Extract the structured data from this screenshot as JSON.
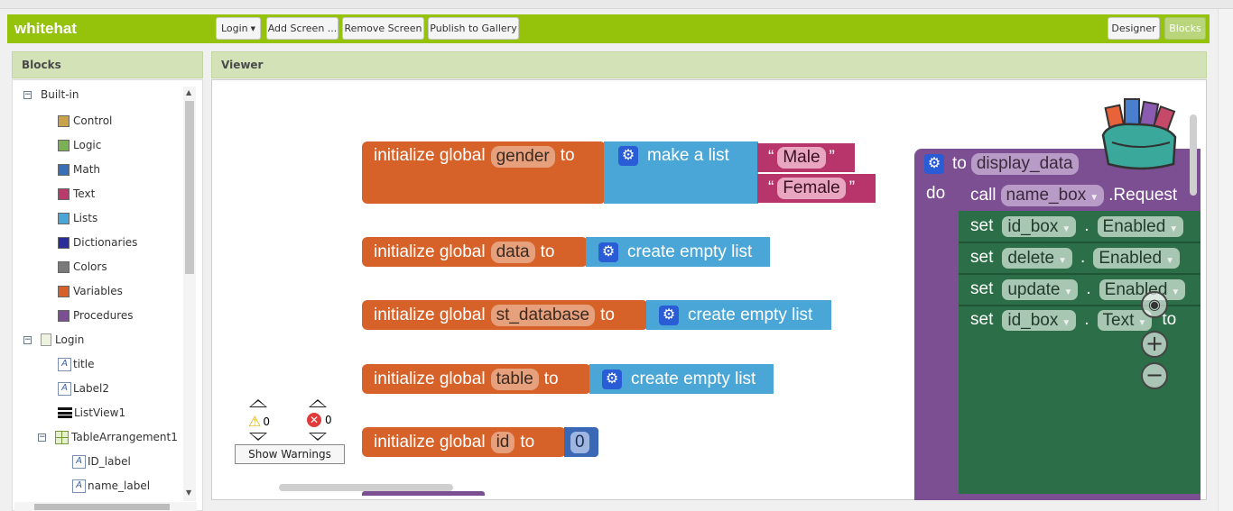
{
  "app": {
    "title": "whitehat",
    "screen_dropdown": "Login",
    "add_screen": "Add Screen ...",
    "remove_screen": "Remove Screen",
    "publish": "Publish to Gallery",
    "designer": "Designer",
    "blocks": "Blocks",
    "accent_color": "#95c30c"
  },
  "blocks_panel": {
    "title": "Blocks",
    "builtin_label": "Built-in",
    "builtin": [
      {
        "label": "Control",
        "color": "#c9a24a"
      },
      {
        "label": "Logic",
        "color": "#7bb154"
      },
      {
        "label": "Math",
        "color": "#3a6fb6"
      },
      {
        "label": "Text",
        "color": "#b93b6b"
      },
      {
        "label": "Lists",
        "color": "#4aa6d6"
      },
      {
        "label": "Dictionaries",
        "color": "#2c2c9a"
      },
      {
        "label": "Colors",
        "color": "#7a7a7a"
      },
      {
        "label": "Variables",
        "color": "#d6622a"
      },
      {
        "label": "Procedures",
        "color": "#7b4f91"
      }
    ],
    "screen_label": "Login",
    "components": [
      {
        "label": "title",
        "icon": "label-icon"
      },
      {
        "label": "Label2",
        "icon": "label-icon"
      },
      {
        "label": "ListView1",
        "icon": "listview-icon"
      }
    ],
    "table_arrangement": "TableArrangement1",
    "table_children": [
      {
        "label": "ID_label",
        "icon": "label-icon"
      },
      {
        "label": "name_label",
        "icon": "label-icon"
      }
    ]
  },
  "viewer": {
    "title": "Viewer",
    "warnings_count": "0",
    "errors_count": "0",
    "show_warnings": "Show Warnings"
  },
  "workspace": {
    "init_prefix": "initialize global",
    "to": "to",
    "make_a_list": "make a list",
    "create_empty_list": "create empty list",
    "quote": "“",
    "quote_close": "”",
    "globals": {
      "gender": "gender",
      "data": "data",
      "st_database": "st_database",
      "table": "table",
      "id": "id"
    },
    "list_items": [
      "Male",
      "Female"
    ],
    "id_value": "0",
    "procedure": {
      "to": "to",
      "name": "display_data",
      "do": "do",
      "call": "call",
      "call_component": "name_box",
      "call_method": ".Request",
      "set": "set",
      "dot": ".",
      "rows": [
        {
          "component": "id_box",
          "property": "Enabled"
        },
        {
          "component": "delete",
          "property": "Enabled"
        },
        {
          "component": "update",
          "property": "Enabled"
        },
        {
          "component": "id_box",
          "property": "Text",
          "suffix": "to"
        }
      ]
    }
  }
}
